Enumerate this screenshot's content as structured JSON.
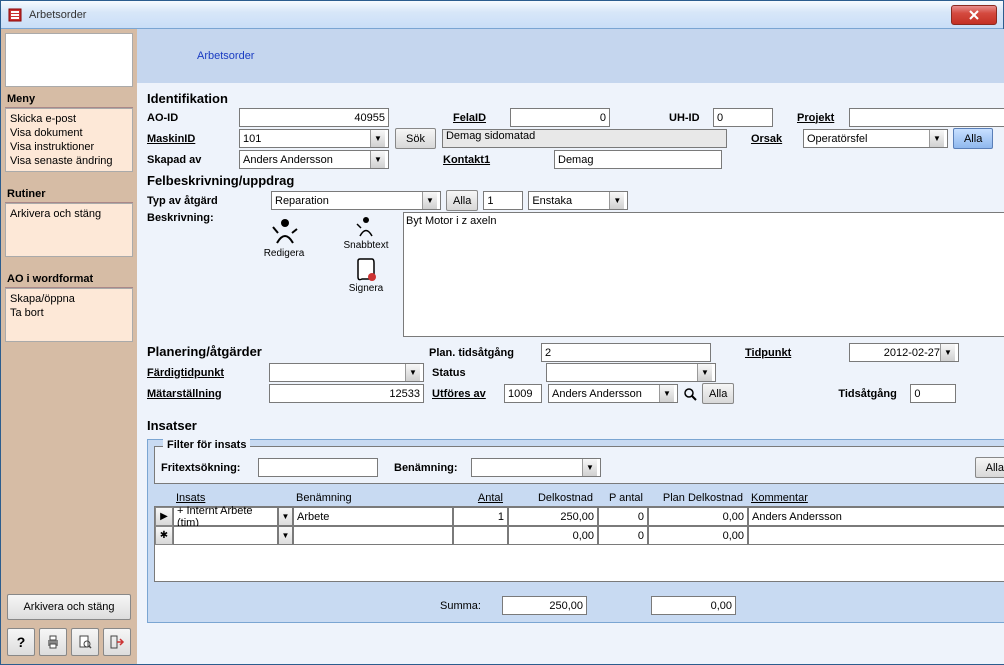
{
  "window": {
    "title": "Arbetsorder"
  },
  "banner": {
    "title": "Arbetsorder"
  },
  "sidebar": {
    "menu_label": "Meny",
    "menu_items": [
      "Skicka e-post",
      "Visa dokument",
      "Visa instruktioner",
      "Visa senaste ändring"
    ],
    "rutiner_label": "Rutiner",
    "rutiner_items": [
      "Arkivera och stäng"
    ],
    "word_label": "AO i wordformat",
    "word_items": [
      "Skapa/öppna",
      "Ta bort"
    ],
    "archive_btn": "Arkivera och stäng"
  },
  "ident": {
    "section": "Identifikation",
    "aoid_label": "AO-ID",
    "aoid": "40955",
    "felaid_label": "FelaID",
    "felaid": "0",
    "uhid_label": "UH-ID",
    "uhid": "0",
    "projekt_label": "Projekt",
    "projekt": "",
    "maskin_label": "MaskinID",
    "maskin": "101",
    "sok": "Sök",
    "maskin_desc": "Demag sidomatad",
    "orsak_label": "Orsak",
    "orsak": "Operatörsfel",
    "alla": "Alla",
    "skapad_label": "Skapad av",
    "skapad": "Anders Andersson",
    "kontakt_label": "Kontakt1",
    "kontakt": "Demag"
  },
  "fel": {
    "section": "Felbeskrivning/uppdrag",
    "typ_label": "Typ av åtgärd",
    "typ": "Reparation",
    "alla": "Alla",
    "num": "1",
    "freq": "Enstaka",
    "beskrivning_label": "Beskrivning:",
    "beskrivning": "Byt Motor i z axeln",
    "redigera": "Redigera",
    "snabbtext": "Snabbtext",
    "signera": "Signera"
  },
  "plan": {
    "section": "Planering/åtgärder",
    "plantid_label": "Plan. tidsåtgång",
    "plantid": "2",
    "tidpunkt_label": "Tidpunkt",
    "tidpunkt": "2012-02-27",
    "fardig_label": "Färdigtidpunkt",
    "fardig": "",
    "status_label": "Status",
    "status": "",
    "matar_label": "Mätarställning",
    "matar": "12533",
    "utfores_label": "Utföres av",
    "utfores_id": "1009",
    "utfores_name": "Anders Andersson",
    "alla": "Alla",
    "tidsatgang_label": "Tidsåtgång",
    "tidsatgang": "0"
  },
  "insatser": {
    "section": "Insatser",
    "filter_legend": "Filter för insats",
    "fritext_label": "Fritextsökning:",
    "benamning_label": "Benämning:",
    "alla": "Alla",
    "cols": {
      "insats": "Insats",
      "benamning": "Benämning",
      "antal": "Antal",
      "delkostnad": "Delkostnad",
      "pantal": "P antal",
      "plandel": "Plan Delkostnad",
      "kommentar": "Kommentar"
    },
    "rows": [
      {
        "insats": "+ Internt Arbete (tim)",
        "benamning": "Arbete",
        "antal": "1",
        "delkostnad": "250,00",
        "pantal": "0",
        "plandel": "0,00",
        "kommentar": "Anders Andersson"
      },
      {
        "insats": "",
        "benamning": "",
        "antal": "",
        "delkostnad": "0,00",
        "pantal": "0",
        "plandel": "0,00",
        "kommentar": ""
      }
    ],
    "summa_label": "Summa:",
    "summa1": "250,00",
    "summa2": "0,00"
  }
}
